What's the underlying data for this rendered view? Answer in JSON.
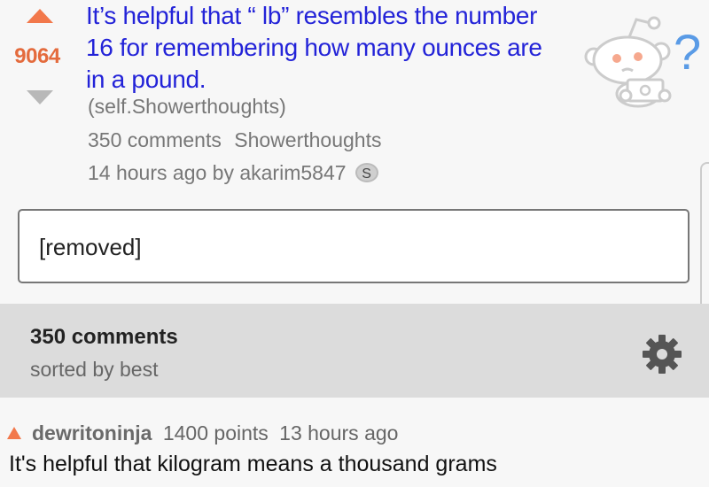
{
  "post": {
    "score": "9064",
    "title": "It’s helpful that “ lb” resembles the number 16 for remembering how many ounces are in a pound.",
    "domain": "(self.Showerthoughts)",
    "comments_link": "350 comments",
    "subreddit": "Showerthoughts",
    "posted": "14 hours ago by akarim5847",
    "badge": "S"
  },
  "mascot": {
    "question_mark": "?"
  },
  "removed": {
    "text": "[removed]"
  },
  "comments_header": {
    "count": "350 comments",
    "sort": "sorted by best"
  },
  "comments": [
    {
      "author": "dewritoninja",
      "points": "1400 points",
      "time": "13 hours ago",
      "body": "It's helpful that kilogram means a thousand grams"
    }
  ],
  "colors": {
    "upvote": "#f2784b",
    "score": "#e46b3d",
    "title_link": "#2323d8",
    "mascot_accent": "#5a9be6"
  }
}
